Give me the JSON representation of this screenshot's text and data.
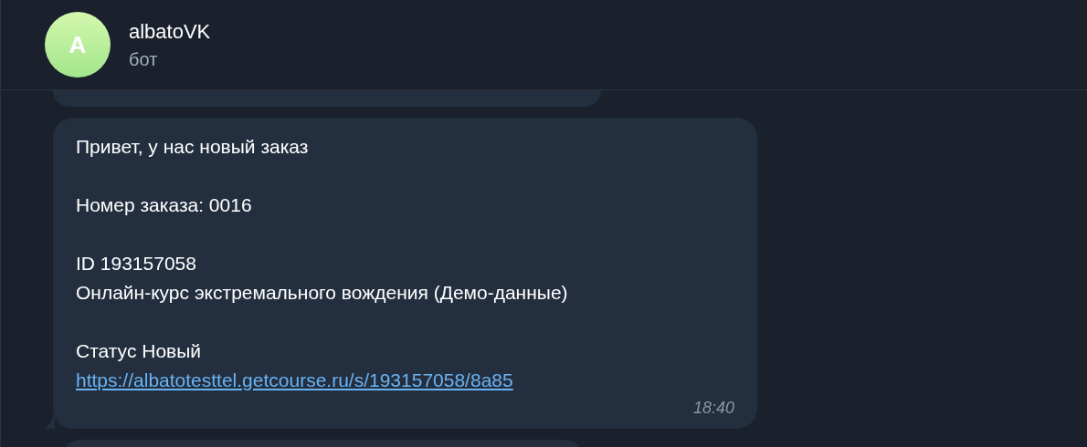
{
  "chat": {
    "name": "albatoVK",
    "subtitle": "бот",
    "avatar_letter": "A"
  },
  "message": {
    "blocks": [
      [
        {
          "kind": "text",
          "text": "Привет, у нас новый заказ"
        }
      ],
      [
        {
          "kind": "text",
          "text": "Номер заказа: 0016"
        }
      ],
      [
        {
          "kind": "text",
          "text": "ID 193157058"
        },
        {
          "kind": "text",
          "text": "Онлайн-курс экстремального вождения (Демо-данные)"
        }
      ],
      [
        {
          "kind": "text",
          "text": "Статус Новый"
        },
        {
          "kind": "link",
          "text": "https://albatotesttel.getcourse.ru/s/193157058/8a85"
        }
      ]
    ],
    "time": "18:40"
  }
}
